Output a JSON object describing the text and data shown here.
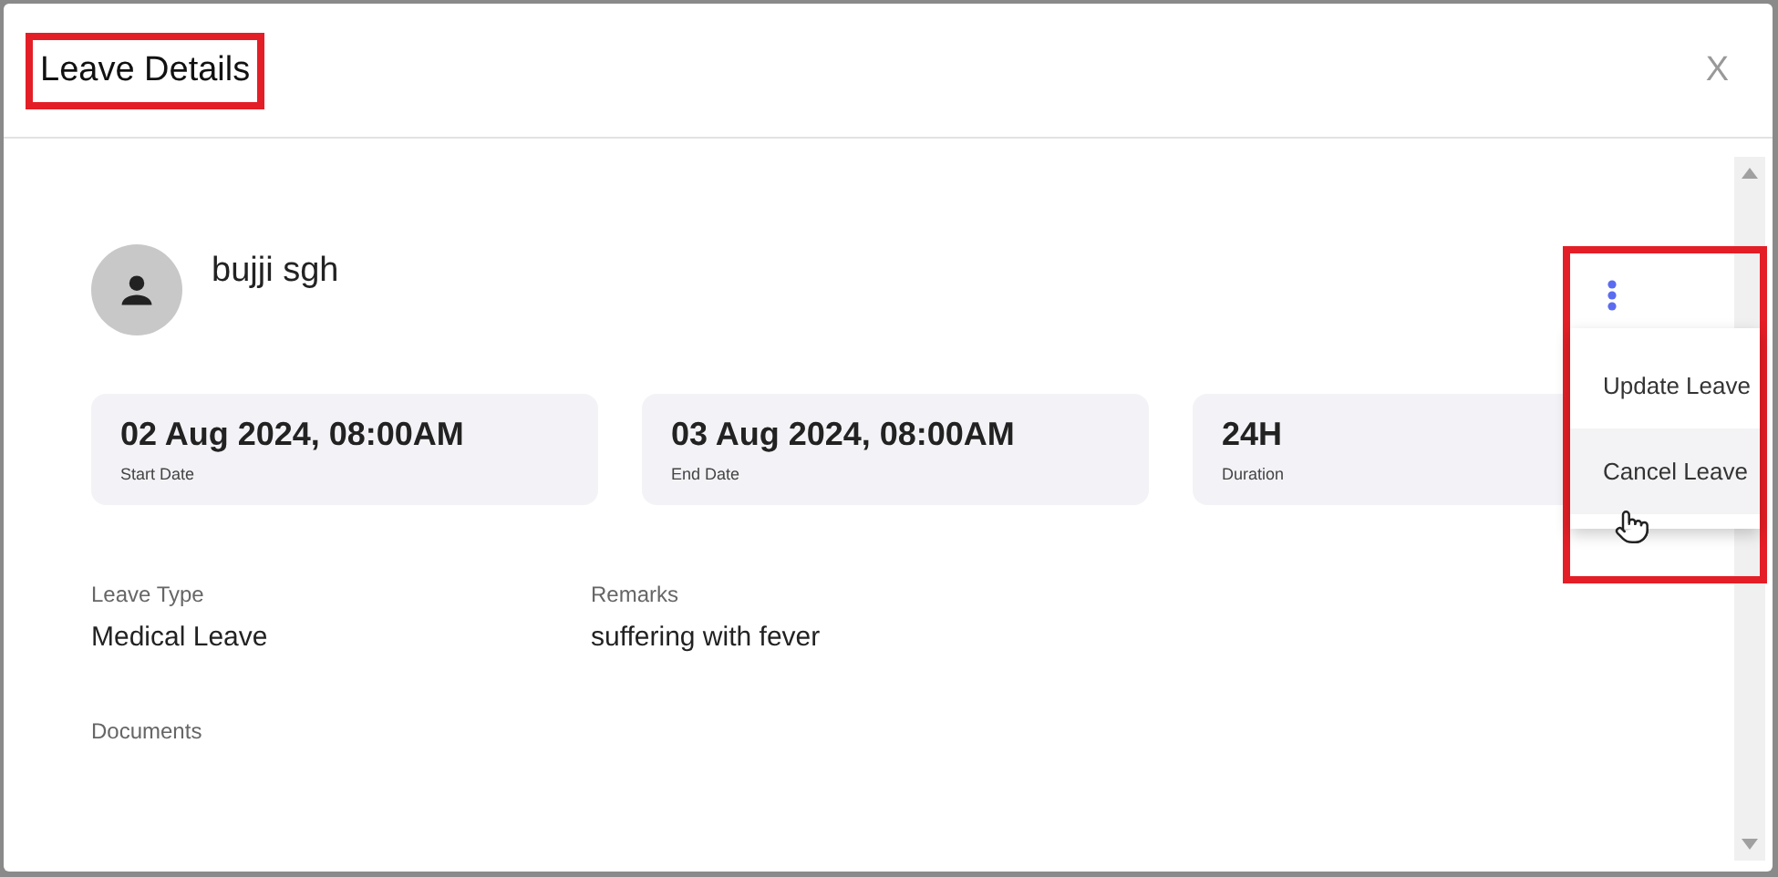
{
  "dialog": {
    "title": "Leave Details",
    "close": "X"
  },
  "employee": {
    "name": "bujji sgh"
  },
  "cards": [
    {
      "value": "02 Aug 2024, 08:00AM",
      "label": "Start Date"
    },
    {
      "value": "03 Aug 2024, 08:00AM",
      "label": "End Date"
    },
    {
      "value": "24H",
      "label": "Duration"
    }
  ],
  "fields": [
    {
      "label": "Leave Type",
      "value": "Medical Leave"
    },
    {
      "label": "Remarks",
      "value": "suffering with fever"
    }
  ],
  "documents": {
    "label": "Documents"
  },
  "menu": [
    {
      "label": "Update Leave",
      "highlighted": false
    },
    {
      "label": "Cancel Leave",
      "highlighted": true
    }
  ]
}
